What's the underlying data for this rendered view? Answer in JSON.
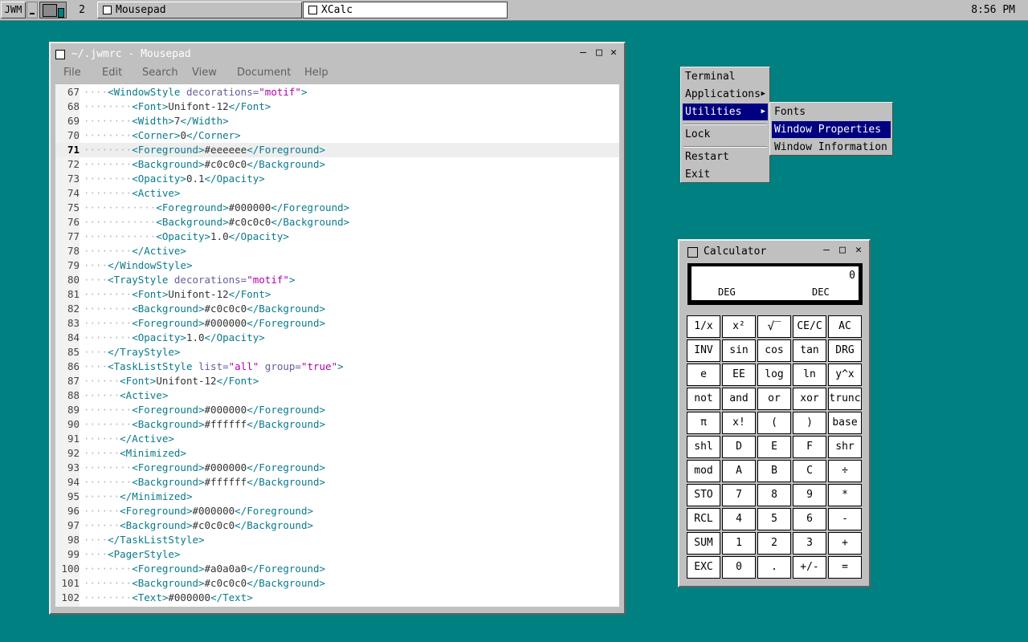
{
  "taskbar": {
    "root_label": "JWM",
    "desktop_number": "2",
    "tasks": [
      {
        "label": "Mousepad",
        "active": false
      },
      {
        "label": "XCalc",
        "active": true
      }
    ],
    "clock": "8:56 PM"
  },
  "mousepad": {
    "title": "~/.jwmrc - Mousepad",
    "controls": {
      "minimize": "—",
      "maximize": "□",
      "close": "✕"
    },
    "menu": [
      "File",
      "Edit",
      "Search",
      "View",
      "Document",
      "Help"
    ],
    "current_line": 71,
    "lines": [
      {
        "n": 67,
        "indent": 1,
        "parts": [
          [
            "tag",
            "<WindowStyle"
          ],
          [
            "att",
            " decorations="
          ],
          [
            "str",
            "\"motif\""
          ],
          [
            "tag",
            ">"
          ]
        ]
      },
      {
        "n": 68,
        "indent": 2,
        "parts": [
          [
            "tag",
            "<Font>"
          ],
          [
            "txt",
            "Unifont-12"
          ],
          [
            "tag",
            "</Font>"
          ]
        ]
      },
      {
        "n": 69,
        "indent": 2,
        "parts": [
          [
            "tag",
            "<Width>"
          ],
          [
            "txt",
            "7"
          ],
          [
            "tag",
            "</Width>"
          ]
        ]
      },
      {
        "n": 70,
        "indent": 2,
        "parts": [
          [
            "tag",
            "<Corner>"
          ],
          [
            "txt",
            "0"
          ],
          [
            "tag",
            "</Corner>"
          ]
        ]
      },
      {
        "n": 71,
        "indent": 2,
        "parts": [
          [
            "tag",
            "<Foreground>"
          ],
          [
            "txt",
            "#eeeeee"
          ],
          [
            "tag",
            "</Foreground>"
          ]
        ]
      },
      {
        "n": 72,
        "indent": 2,
        "parts": [
          [
            "tag",
            "<Background>"
          ],
          [
            "txt",
            "#c0c0c0"
          ],
          [
            "tag",
            "</Background>"
          ]
        ]
      },
      {
        "n": 73,
        "indent": 2,
        "parts": [
          [
            "tag",
            "<Opacity>"
          ],
          [
            "txt",
            "0.1"
          ],
          [
            "tag",
            "</Opacity>"
          ]
        ]
      },
      {
        "n": 74,
        "indent": 2,
        "parts": [
          [
            "tag",
            "<Active>"
          ]
        ]
      },
      {
        "n": 75,
        "indent": 3,
        "parts": [
          [
            "tag",
            "<Foreground>"
          ],
          [
            "txt",
            "#000000"
          ],
          [
            "tag",
            "</Foreground>"
          ]
        ]
      },
      {
        "n": 76,
        "indent": 3,
        "parts": [
          [
            "tag",
            "<Background>"
          ],
          [
            "txt",
            "#c0c0c0"
          ],
          [
            "tag",
            "</Background>"
          ]
        ]
      },
      {
        "n": 77,
        "indent": 3,
        "parts": [
          [
            "tag",
            "<Opacity>"
          ],
          [
            "txt",
            "1.0"
          ],
          [
            "tag",
            "</Opacity>"
          ]
        ]
      },
      {
        "n": 78,
        "indent": 2,
        "parts": [
          [
            "tag",
            "</Active>"
          ]
        ]
      },
      {
        "n": 79,
        "indent": 1,
        "parts": [
          [
            "tag",
            "</WindowStyle>"
          ]
        ]
      },
      {
        "n": 80,
        "indent": 1,
        "parts": [
          [
            "tag",
            "<TrayStyle"
          ],
          [
            "att",
            " decorations="
          ],
          [
            "str",
            "\"motif\""
          ],
          [
            "tag",
            ">"
          ]
        ]
      },
      {
        "n": 81,
        "indent": 2,
        "parts": [
          [
            "tag",
            "<Font>"
          ],
          [
            "txt",
            "Unifont-12"
          ],
          [
            "tag",
            "</Font>"
          ]
        ]
      },
      {
        "n": 82,
        "indent": 2,
        "parts": [
          [
            "tag",
            "<Background>"
          ],
          [
            "txt",
            "#c0c0c0"
          ],
          [
            "tag",
            "</Background>"
          ]
        ]
      },
      {
        "n": 83,
        "indent": 2,
        "parts": [
          [
            "tag",
            "<Foreground>"
          ],
          [
            "txt",
            "#000000"
          ],
          [
            "tag",
            "</Foreground>"
          ]
        ]
      },
      {
        "n": 84,
        "indent": 2,
        "parts": [
          [
            "tag",
            "<Opacity>"
          ],
          [
            "txt",
            "1.0"
          ],
          [
            "tag",
            "</Opacity>"
          ]
        ]
      },
      {
        "n": 85,
        "indent": 1,
        "parts": [
          [
            "tag",
            "</TrayStyle>"
          ]
        ]
      },
      {
        "n": 86,
        "indent": 1,
        "parts": [
          [
            "tag",
            "<TaskListStyle"
          ],
          [
            "att",
            " list="
          ],
          [
            "str",
            "\"all\""
          ],
          [
            "att",
            " group="
          ],
          [
            "str",
            "\"true\""
          ],
          [
            "tag",
            ">"
          ]
        ]
      },
      {
        "n": 87,
        "indent": 1.5,
        "parts": [
          [
            "tag",
            "<Font>"
          ],
          [
            "txt",
            "Unifont-12"
          ],
          [
            "tag",
            "</Font>"
          ]
        ]
      },
      {
        "n": 88,
        "indent": 1.5,
        "parts": [
          [
            "tag",
            "<Active>"
          ]
        ]
      },
      {
        "n": 89,
        "indent": 2,
        "parts": [
          [
            "tag",
            "<Foreground>"
          ],
          [
            "txt",
            "#000000"
          ],
          [
            "tag",
            "</Foreground>"
          ]
        ]
      },
      {
        "n": 90,
        "indent": 2,
        "parts": [
          [
            "tag",
            "<Background>"
          ],
          [
            "txt",
            "#ffffff"
          ],
          [
            "tag",
            "</Background>"
          ]
        ]
      },
      {
        "n": 91,
        "indent": 1.5,
        "parts": [
          [
            "tag",
            "</Active>"
          ]
        ]
      },
      {
        "n": 92,
        "indent": 1.5,
        "parts": [
          [
            "tag",
            "<Minimized>"
          ]
        ]
      },
      {
        "n": 93,
        "indent": 2,
        "parts": [
          [
            "tag",
            "<Foreground>"
          ],
          [
            "txt",
            "#000000"
          ],
          [
            "tag",
            "</Foreground>"
          ]
        ]
      },
      {
        "n": 94,
        "indent": 2,
        "parts": [
          [
            "tag",
            "<Background>"
          ],
          [
            "txt",
            "#ffffff"
          ],
          [
            "tag",
            "</Background>"
          ]
        ]
      },
      {
        "n": 95,
        "indent": 1.5,
        "parts": [
          [
            "tag",
            "</Minimized>"
          ]
        ]
      },
      {
        "n": 96,
        "indent": 1.5,
        "parts": [
          [
            "tag",
            "<Foreground>"
          ],
          [
            "txt",
            "#000000"
          ],
          [
            "tag",
            "</Foreground>"
          ]
        ]
      },
      {
        "n": 97,
        "indent": 1.5,
        "parts": [
          [
            "tag",
            "<Background>"
          ],
          [
            "txt",
            "#c0c0c0"
          ],
          [
            "tag",
            "</Background>"
          ]
        ]
      },
      {
        "n": 98,
        "indent": 1,
        "parts": [
          [
            "tag",
            "</TaskListStyle>"
          ]
        ]
      },
      {
        "n": 99,
        "indent": 1,
        "parts": [
          [
            "tag",
            "<PagerStyle>"
          ]
        ]
      },
      {
        "n": 100,
        "indent": 2,
        "parts": [
          [
            "tag",
            "<Foreground>"
          ],
          [
            "txt",
            "#a0a0a0"
          ],
          [
            "tag",
            "</Foreground>"
          ]
        ]
      },
      {
        "n": 101,
        "indent": 2,
        "parts": [
          [
            "tag",
            "<Background>"
          ],
          [
            "txt",
            "#c0c0c0"
          ],
          [
            "tag",
            "</Background>"
          ]
        ]
      },
      {
        "n": 102,
        "indent": 2,
        "parts": [
          [
            "tag",
            "<Text>"
          ],
          [
            "txt",
            "#000000"
          ],
          [
            "tag",
            "</Text>"
          ]
        ]
      }
    ]
  },
  "root_menu": {
    "items": [
      {
        "label": "Terminal",
        "submenu": false,
        "selected": false
      },
      {
        "label": "Applications",
        "submenu": true,
        "selected": false
      },
      {
        "label": "Utilities",
        "submenu": true,
        "selected": true
      },
      {
        "separator": true
      },
      {
        "label": "Lock",
        "submenu": false,
        "selected": false
      },
      {
        "separator": true
      },
      {
        "label": "Restart",
        "submenu": false,
        "selected": false
      },
      {
        "label": "Exit",
        "submenu": false,
        "selected": false
      }
    ],
    "submenu_items": [
      {
        "label": "Fonts",
        "selected": false
      },
      {
        "label": "Window Properties",
        "selected": true
      },
      {
        "label": "Window Information",
        "selected": false
      }
    ],
    "arrow_glyph": "▶"
  },
  "calculator": {
    "title": "Calculator",
    "controls": {
      "minimize": "—",
      "maximize": "□",
      "close": "✕"
    },
    "display": {
      "value": "0",
      "angle_mode": "DEG",
      "base_mode": "DEC"
    },
    "keys": [
      [
        "1/x",
        "x²",
        "√‾",
        "CE/C",
        "AC"
      ],
      [
        "INV",
        "sin",
        "cos",
        "tan",
        "DRG"
      ],
      [
        "e",
        "EE",
        "log",
        "ln",
        "y^x"
      ],
      [
        "not",
        "and",
        "or",
        "xor",
        "trunc"
      ],
      [
        "π",
        "x!",
        "(",
        ")",
        "base"
      ],
      [
        "shl",
        "D",
        "E",
        "F",
        "shr"
      ],
      [
        "mod",
        "A",
        "B",
        "C",
        "÷"
      ],
      [
        "STO",
        "7",
        "8",
        "9",
        "*"
      ],
      [
        "RCL",
        "4",
        "5",
        "6",
        "-"
      ],
      [
        "SUM",
        "1",
        "2",
        "3",
        "+"
      ],
      [
        "EXC",
        "0",
        ".",
        "+/-",
        "="
      ]
    ]
  },
  "colors": {
    "desktop": "#008080",
    "panel": "#c0c0c0",
    "menu_selection": "#000080",
    "current_line": "#eeeeee"
  }
}
